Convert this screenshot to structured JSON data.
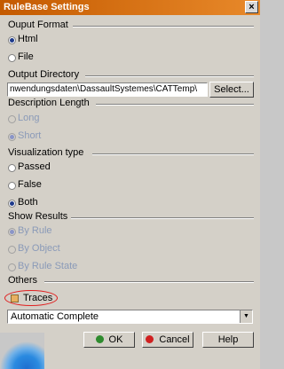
{
  "window": {
    "title": "RuleBase Settings",
    "close_label": "×"
  },
  "output_format": {
    "label": "Ouput Format",
    "options": [
      {
        "label": "Html",
        "selected": true
      },
      {
        "label": "File",
        "selected": false
      }
    ]
  },
  "output_directory": {
    "label": "Output Directory",
    "value": "nwendungsdaten\\DassaultSystemes\\CATTemp\\",
    "select_label": "Select..."
  },
  "description_length": {
    "label": "Description Length",
    "options": [
      {
        "label": "Long",
        "selected": false,
        "disabled": true
      },
      {
        "label": "Short",
        "selected": true,
        "disabled": true
      }
    ]
  },
  "visualization_type": {
    "label": "Visualization type",
    "options": [
      {
        "label": "Passed",
        "selected": false
      },
      {
        "label": "False",
        "selected": false
      },
      {
        "label": "Both",
        "selected": true
      }
    ]
  },
  "show_results": {
    "label": "Show Results",
    "options": [
      {
        "label": "By Rule",
        "selected": true,
        "disabled": true
      },
      {
        "label": "By Object",
        "selected": false,
        "disabled": true
      },
      {
        "label": "By Rule State",
        "selected": false,
        "disabled": true
      }
    ]
  },
  "others": {
    "label": "Others",
    "traces_label": "Traces",
    "combo_value": "Automatic Complete"
  },
  "buttons": {
    "ok": "OK",
    "cancel": "Cancel",
    "help": "Help"
  },
  "colors": {
    "title_start": "#c45a00",
    "title_end": "#e8892a",
    "highlight_oval": "#e02020",
    "ok_dot": "#2e8b2e",
    "cancel_dot": "#d02020"
  }
}
